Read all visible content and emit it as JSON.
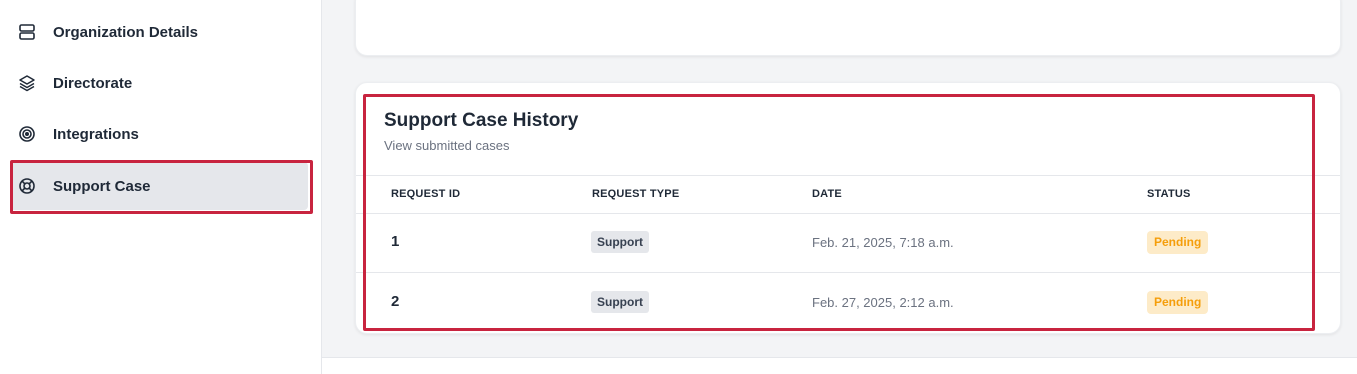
{
  "sidebar": {
    "items": [
      {
        "label": "Organization Details",
        "icon": "server-icon"
      },
      {
        "label": "Directorate",
        "icon": "layers-icon"
      },
      {
        "label": "Integrations",
        "icon": "target-icon"
      },
      {
        "label": "Support Case",
        "icon": "lifebuoy-icon",
        "active": true
      }
    ]
  },
  "support_history": {
    "title": "Support Case History",
    "subtitle": "View submitted cases",
    "columns": [
      "REQUEST ID",
      "REQUEST TYPE",
      "DATE",
      "STATUS"
    ],
    "rows": [
      {
        "id": "1",
        "type": "Support",
        "date": "Feb. 21, 2025, 7:18 a.m.",
        "status": "Pending"
      },
      {
        "id": "2",
        "type": "Support",
        "date": "Feb. 27, 2025, 2:12 a.m.",
        "status": "Pending"
      }
    ]
  },
  "colors": {
    "highlight": "#c8243f",
    "pending_text": "#f59e0b",
    "pending_bg": "#fdebc8",
    "active_bg": "#e5e7eb"
  }
}
